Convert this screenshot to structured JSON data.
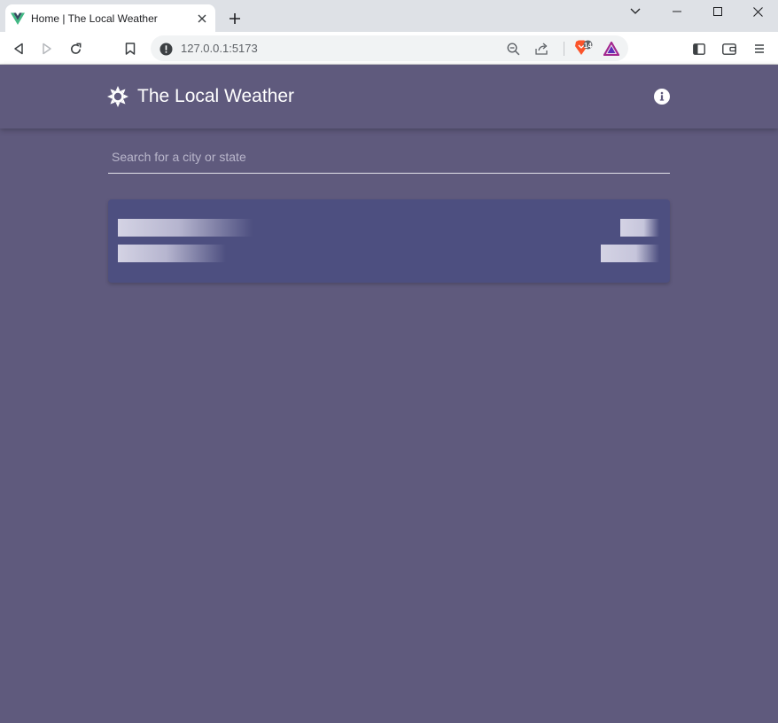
{
  "browser": {
    "tab_title": "Home | The Local Weather",
    "url": "127.0.0.1:5173",
    "extension_badge": "14"
  },
  "header": {
    "title": "The Local Weather",
    "logo_icon": "sun-icon",
    "info_icon": "info-icon"
  },
  "search": {
    "placeholder": "Search for a city or state",
    "value": ""
  },
  "colors": {
    "app_background": "#5f5a7d",
    "card_background": "#4d4f80"
  }
}
